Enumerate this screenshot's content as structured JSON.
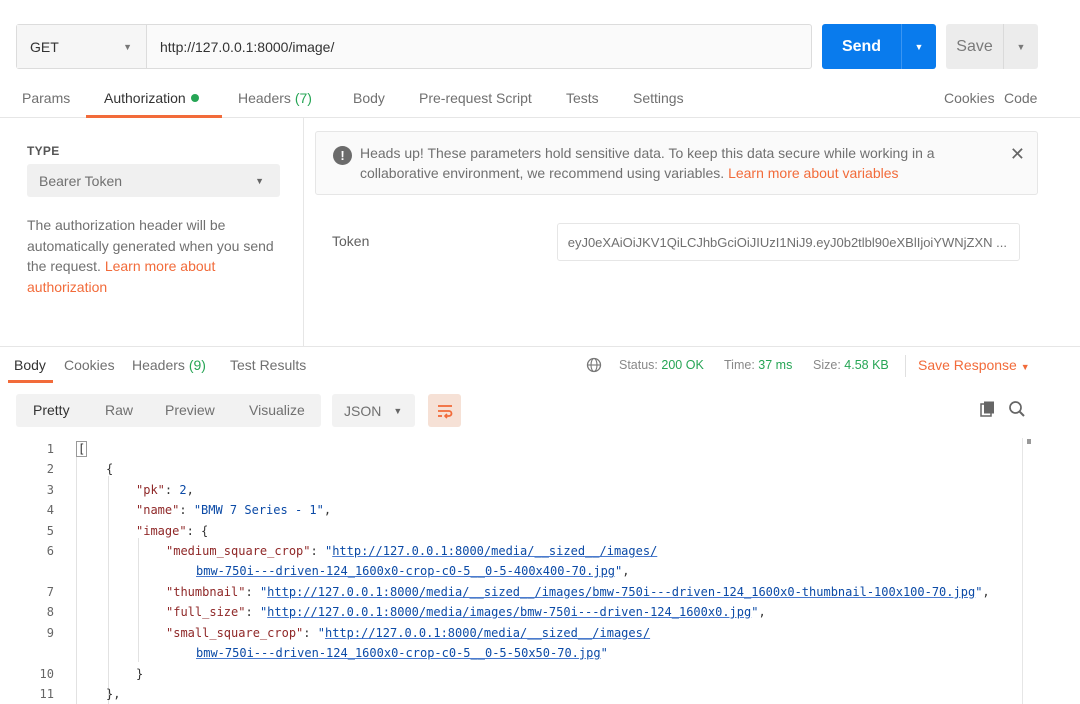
{
  "request": {
    "method": "GET",
    "url": "http://127.0.0.1:8000/image/",
    "send_label": "Send",
    "save_label": "Save"
  },
  "request_tabs": {
    "params": "Params",
    "authorization": "Authorization",
    "headers": "Headers",
    "headers_count": "(7)",
    "body": "Body",
    "prerequest": "Pre-request Script",
    "tests": "Tests",
    "settings": "Settings",
    "cookies": "Cookies",
    "code": "Code"
  },
  "auth": {
    "type_label": "TYPE",
    "type_value": "Bearer Token",
    "description": "The authorization header will be automatically generated when you send the request. ",
    "learn_more": "Learn more about authorization",
    "alert_text": "Heads up! These parameters hold sensitive data. To keep this data secure while working in a collaborative environment, we recommend using variables. ",
    "alert_link": "Learn more about variables",
    "token_label": "Token",
    "token_value": "eyJ0eXAiOiJKV1QiLCJhbGciOiJIUzI1NiJ9.eyJ0b2tlbl90eXBlIjoiYWNjZXN ..."
  },
  "response": {
    "tabs": {
      "body": "Body",
      "cookies": "Cookies",
      "headers": "Headers",
      "headers_count": "(9)",
      "test_results": "Test Results"
    },
    "status_label": "Status:",
    "status_value": "200 OK",
    "time_label": "Time:",
    "time_value": "37 ms",
    "size_label": "Size:",
    "size_value": "4.58 KB",
    "save_response": "Save Response"
  },
  "viewer": {
    "pretty": "Pretty",
    "raw": "Raw",
    "preview": "Preview",
    "visualize": "Visualize",
    "format": "JSON"
  },
  "code_lines": {
    "numbers": [
      "1",
      "2",
      "3",
      "4",
      "5",
      "6",
      "7",
      "8",
      "9",
      "10",
      "11"
    ],
    "open_bracket": "[",
    "open_brace": "{",
    "pk_key": "\"pk\"",
    "pk_value": "2",
    "name_key": "\"name\"",
    "name_value": "\"BMW 7 Series - 1\"",
    "image_key": "\"image\"",
    "msc_key": "\"medium_square_crop\"",
    "msc_value_1": "http://127.0.0.1:8000/media/__sized__/images/",
    "msc_value_2": "bmw-750i---driven-124_1600x0-crop-c0-5__0-5-400x400-70.jpg",
    "thumb_key": "\"thumbnail\"",
    "thumb_value": "http://127.0.0.1:8000/media/__sized__/images/bmw-750i---driven-124_1600x0-thumbnail-100x100-70.jpg",
    "full_key": "\"full_size\"",
    "full_value": "http://127.0.0.1:8000/media/images/bmw-750i---driven-124_1600x0.jpg",
    "ssc_key": "\"small_square_crop\"",
    "ssc_value_1": "http://127.0.0.1:8000/media/__sized__/images/",
    "ssc_value_2": "bmw-750i---driven-124_1600x0-crop-c0-5__0-5-50x50-70.jpg",
    "close_brace_inner": "}",
    "close_brace_outer": "},"
  }
}
